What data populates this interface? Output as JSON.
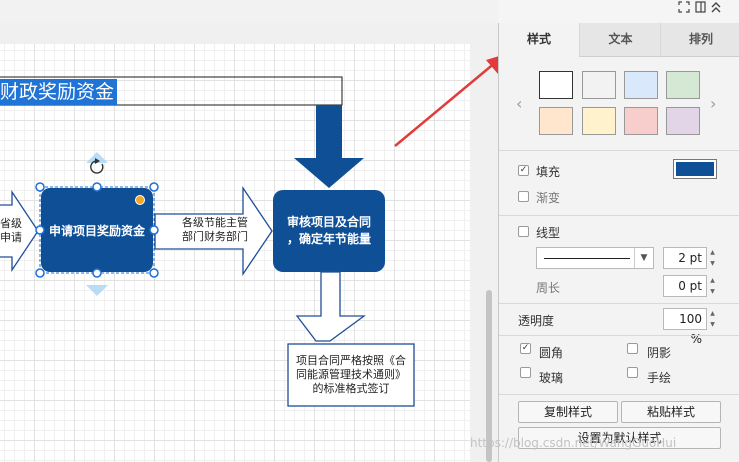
{
  "diagram": {
    "title_text": "财政奖励资金",
    "left_text_lines": [
      "省级",
      "申请"
    ],
    "box1": {
      "label": "申请项目奖励资金",
      "fill": "#0f4f96"
    },
    "arrow_label_lines": [
      "各级节能主管",
      "部门财务部门"
    ],
    "box2": {
      "line1": "审核项目及合同",
      "line2": "，确定年节能量",
      "fill": "#0f4f96"
    },
    "box3": {
      "line1": "项目合同严格按照《合",
      "line2": "同能源管理技术通则》",
      "line3": "的标准格式签订"
    },
    "selection_color": "#1f6fd6"
  },
  "panel": {
    "tabs": [
      {
        "label": "样式",
        "active": true
      },
      {
        "label": "文本",
        "active": false
      },
      {
        "label": "排列",
        "active": false
      }
    ],
    "swatches_row1": [
      "#ffffff",
      "#f2f2f2",
      "#dae8fc",
      "#d5e8d4"
    ],
    "swatches_row2": [
      "#ffe6cc",
      "#fff2cc",
      "#f8cecc",
      "#e1d5e7"
    ],
    "fill": {
      "label": "填充",
      "checked": true,
      "color": "#0f4f96"
    },
    "gradient": {
      "label": "渐变",
      "checked": false
    },
    "line": {
      "label": "线型",
      "checked": false,
      "width_value": "2 pt"
    },
    "perimeter": {
      "label": "周长",
      "value": "0 pt"
    },
    "opacity": {
      "label": "透明度",
      "value": "100 %"
    },
    "rounded": {
      "label": "圆角",
      "checked": true
    },
    "shadow": {
      "label": "阴影",
      "checked": false
    },
    "glass": {
      "label": "玻璃",
      "checked": false
    },
    "sketch": {
      "label": "手绘",
      "checked": false
    },
    "copy_style_label": "复制样式",
    "paste_style_label": "粘贴样式",
    "set_default_label": "设置为默认样式"
  },
  "watermark": "https://blog.csdn.net/WangGuoHui",
  "annotation": {
    "arrow_color": "#e03c3c"
  }
}
